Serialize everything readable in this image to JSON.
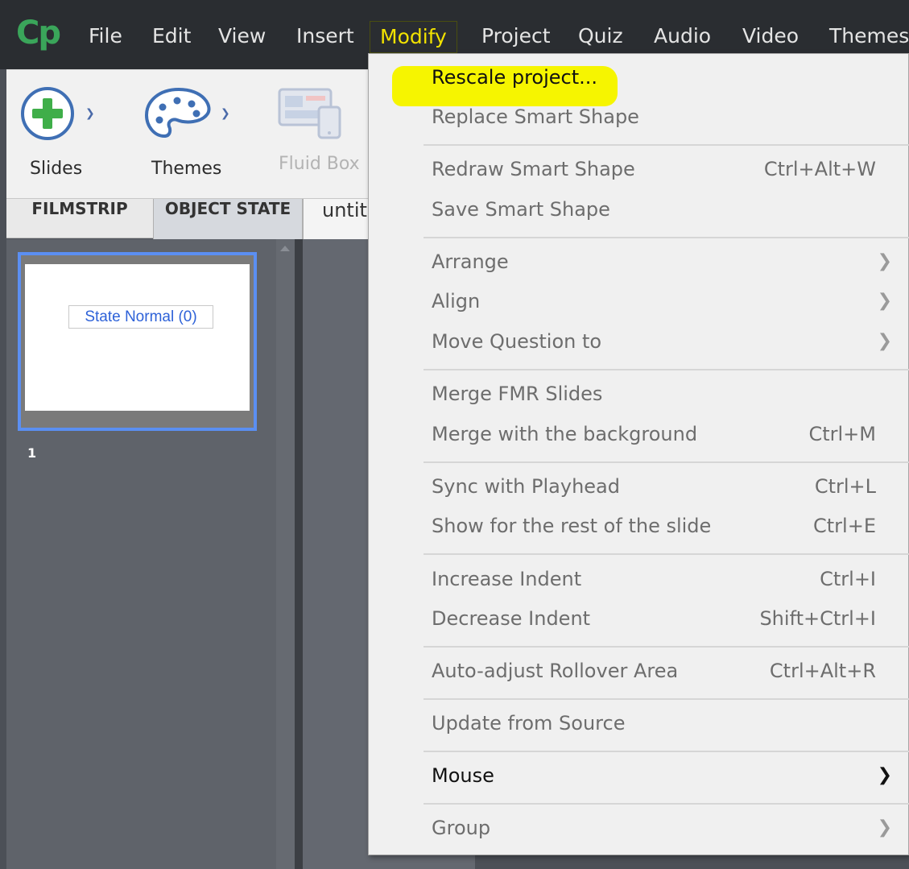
{
  "menubar": {
    "logo": "Cp",
    "items": [
      {
        "label": "File"
      },
      {
        "label": "Edit"
      },
      {
        "label": "View"
      },
      {
        "label": "Insert"
      },
      {
        "label": "Modify",
        "active": true
      },
      {
        "label": "Project"
      },
      {
        "label": "Quiz"
      },
      {
        "label": "Audio"
      },
      {
        "label": "Video"
      },
      {
        "label": "Themes"
      }
    ]
  },
  "toolbar": {
    "slides_label": "Slides",
    "themes_label": "Themes",
    "fluidbox_label": "Fluid Box",
    "icons": [
      "add-slide-icon",
      "palette-icon",
      "fluid-box-icon"
    ]
  },
  "tabs": {
    "filmstrip": "FILMSTRIP",
    "object_state": "OBJECT STATE",
    "document": "untit"
  },
  "filmstrip": {
    "thumbnail_text": "State Normal (0)",
    "slide_number": "1"
  },
  "modify_menu": {
    "items": [
      {
        "label": "Rescale project...",
        "shortcut": "",
        "submenu": false,
        "enabled": true,
        "highlighted": true
      },
      {
        "label": "Replace Smart Shape",
        "shortcut": "",
        "submenu": false,
        "enabled": false
      },
      {
        "label": "Redraw Smart Shape",
        "shortcut": "Ctrl+Alt+W",
        "submenu": false,
        "enabled": false
      },
      {
        "label": "Save Smart Shape",
        "shortcut": "",
        "submenu": false,
        "enabled": false
      },
      {
        "label": "Arrange",
        "shortcut": "",
        "submenu": true,
        "enabled": false
      },
      {
        "label": "Align",
        "shortcut": "",
        "submenu": true,
        "enabled": false
      },
      {
        "label": "Move Question to",
        "shortcut": "",
        "submenu": true,
        "enabled": false
      },
      {
        "label": "Merge FMR Slides",
        "shortcut": "",
        "submenu": false,
        "enabled": false
      },
      {
        "label": "Merge with the background",
        "shortcut": "Ctrl+M",
        "submenu": false,
        "enabled": false
      },
      {
        "label": "Sync with Playhead",
        "shortcut": "Ctrl+L",
        "submenu": false,
        "enabled": false
      },
      {
        "label": "Show for the rest of the slide",
        "shortcut": "Ctrl+E",
        "submenu": false,
        "enabled": false
      },
      {
        "label": "Increase Indent",
        "shortcut": "Ctrl+I",
        "submenu": false,
        "enabled": false
      },
      {
        "label": "Decrease Indent",
        "shortcut": "Shift+Ctrl+I",
        "submenu": false,
        "enabled": false
      },
      {
        "label": "Auto-adjust Rollover Area",
        "shortcut": "Ctrl+Alt+R",
        "submenu": false,
        "enabled": false
      },
      {
        "label": "Update from Source",
        "shortcut": "",
        "submenu": false,
        "enabled": false
      },
      {
        "label": "Mouse",
        "shortcut": "",
        "submenu": true,
        "enabled": true
      },
      {
        "label": "Group",
        "shortcut": "",
        "submenu": true,
        "enabled": false
      }
    ]
  },
  "colors": {
    "accent_green": "#3aa55a",
    "highlight_yellow": "#f6f500",
    "menu_active_text": "#f2e200",
    "selection_blue": "#5b8ff2"
  }
}
